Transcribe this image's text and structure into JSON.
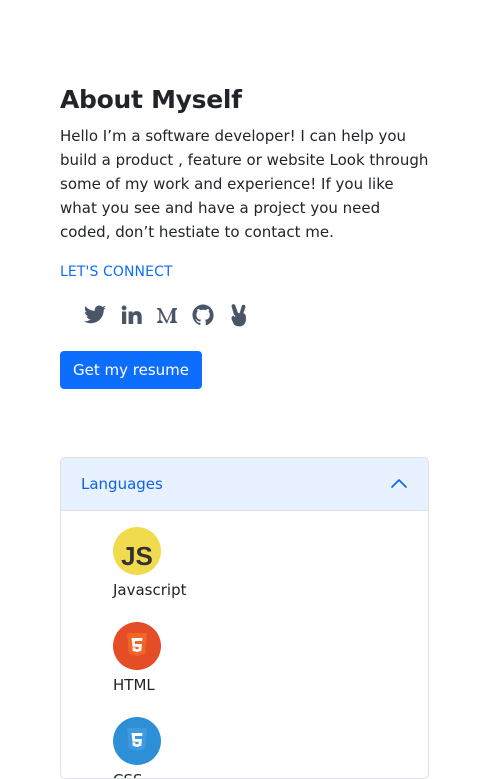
{
  "about": {
    "heading": "About Myself",
    "bio": "Hello I’m a software developer! I can help you build a product , feature or website Look through some of my work and experience! If you like what you see and have a project you need coded, don’t hestiate to contact me.",
    "connect_label": "LET'S CONNECT",
    "socials": [
      "twitter-icon",
      "linkedin-icon",
      "medium-icon",
      "github-icon",
      "angellist-icon"
    ],
    "resume_label": "Get my resume"
  },
  "skills": {
    "accordion_title": "Languages",
    "expanded": true,
    "items": [
      {
        "name": "Javascript",
        "icon": "javascript-icon",
        "color": "#f0db4f"
      },
      {
        "name": "HTML",
        "icon": "html5-icon",
        "color": "#e44d26"
      },
      {
        "name": "CSS",
        "icon": "css3-icon",
        "color": "#2d8fd5"
      }
    ]
  },
  "colors": {
    "primary": "#0d6efd",
    "accordion_header_bg": "#e7f1ff",
    "icon": "#4a5568"
  }
}
